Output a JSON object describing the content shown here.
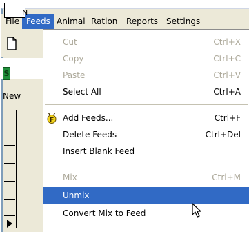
{
  "menubar": {
    "items": [
      {
        "label": "File"
      },
      {
        "label": "Feeds"
      },
      {
        "label": "Animal"
      },
      {
        "label": "Ration"
      },
      {
        "label": "Reports"
      },
      {
        "label": "Settings"
      }
    ]
  },
  "background": {
    "tab_badge": "S",
    "new_label": "New",
    "grid_head_label": "N"
  },
  "feeds_menu": {
    "cut": {
      "label": "Cut",
      "shortcut": "Ctrl+X"
    },
    "copy": {
      "label": "Copy",
      "shortcut": "Ctrl+C"
    },
    "paste": {
      "label": "Paste",
      "shortcut": "Ctrl+V"
    },
    "select_all": {
      "label": "Select All",
      "shortcut": "Ctrl+A"
    },
    "add_feeds": {
      "label": "Add Feeds...",
      "shortcut": "Ctrl+F"
    },
    "delete_feeds": {
      "label": "Delete Feeds",
      "shortcut": "Ctrl+Del"
    },
    "insert_blank": {
      "label": "Insert Blank Feed"
    },
    "mix": {
      "label": "Mix",
      "shortcut": "Ctrl+M"
    },
    "unmix": {
      "label": "Unmix"
    },
    "convert_mix": {
      "label": "Convert Mix to Feed"
    }
  },
  "colors": {
    "selection": "#316ac5",
    "disabled_text": "#aca899",
    "menu_background": "#ffffff",
    "window_face": "#ece9d8"
  }
}
